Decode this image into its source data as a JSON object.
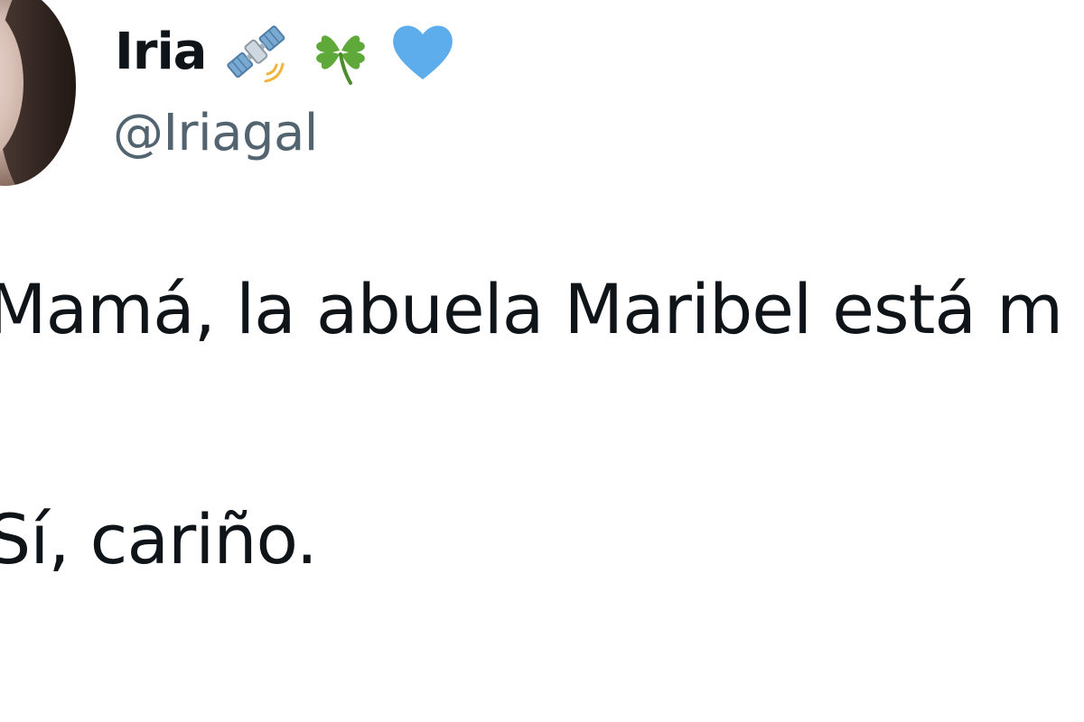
{
  "author": {
    "display_name": "Iria",
    "handle": "@Iriagal",
    "name_emojis": [
      "satellite-icon",
      "four-leaf-clover-icon",
      "blue-heart-icon"
    ]
  },
  "tweet": {
    "lines": [
      "Mamá, la abuela Maribel está m",
      "Sí, cariño."
    ]
  },
  "colors": {
    "text_primary": "#0f1419",
    "text_secondary": "#536471",
    "clover_green": "#5fa83a",
    "heart_blue": "#5dadec",
    "satellite_blue": "#8fb8d8"
  }
}
